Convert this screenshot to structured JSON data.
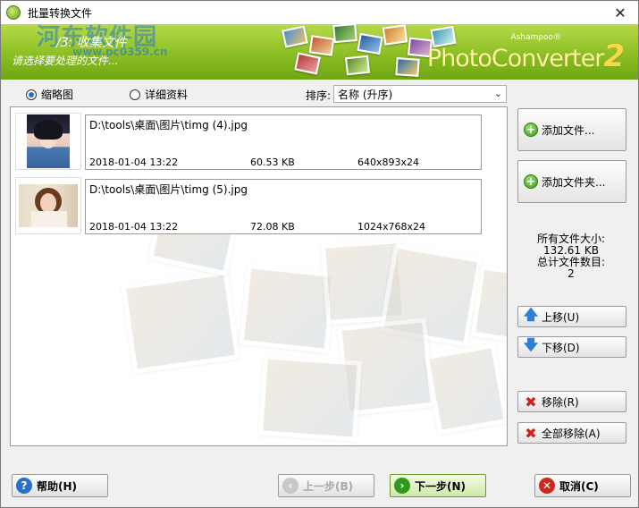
{
  "window": {
    "title": "批量转换文件",
    "close_label": "✕"
  },
  "banner": {
    "step": "/3: 收集文件",
    "subtitle": "请选择要处理的文件...",
    "watermark": "河东软件园",
    "watermark_url": "www.pc0359.cn",
    "brand_maker": "Ashampoo®",
    "brand_product": "PhotoConverter",
    "brand_version": "2"
  },
  "view": {
    "thumbnails_label": "缩略图",
    "details_label": "详细资料",
    "selected": "thumbnails",
    "sort_label": "排序:",
    "sort_value": "名称 (升序)"
  },
  "files": [
    {
      "path": "D:\\tools\\桌面\\图片\\timg (4).jpg",
      "date": "2018-01-04 13:22",
      "size": "60.53 KB",
      "dimensions": "640x893x24"
    },
    {
      "path": "D:\\tools\\桌面\\图片\\timg (5).jpg",
      "date": "2018-01-04 13:22",
      "size": "72.08 KB",
      "dimensions": "1024x768x24"
    }
  ],
  "sidebar": {
    "add_files": "添加文件...",
    "add_folder": "添加文件夹...",
    "total_size_label": "所有文件大小:",
    "total_size_value": "132.61 KB",
    "total_count_label": "总计文件数目:",
    "total_count_value": "2",
    "move_up": "上移(U)",
    "move_down": "下移(D)",
    "remove": "移除(R)",
    "remove_all": "全部移除(A)"
  },
  "footer": {
    "help": "帮助(H)",
    "back": "上一步(B)",
    "next": "下一步(N)",
    "cancel": "取消(C)"
  },
  "colors": {
    "banner_green": "#8bbf24",
    "help_icon": "#2a6fc8",
    "next_icon": "#2f9a1e",
    "cancel_icon": "#c82a1e"
  }
}
